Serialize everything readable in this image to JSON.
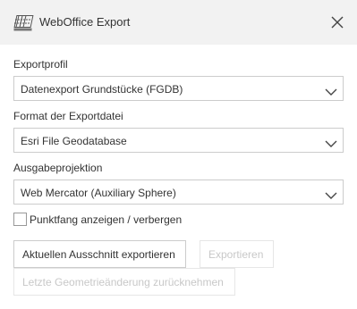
{
  "window": {
    "title": "WebOffice Export",
    "icon": "export-map-icon",
    "close_icon": "close-icon"
  },
  "form": {
    "export_profile": {
      "label": "Exportprofil",
      "value": "Datenexport Grundstücke (FGDB)"
    },
    "export_format": {
      "label": "Format der Exportdatei",
      "value": "Esri File Geodatabase"
    },
    "output_projection": {
      "label": "Ausgabeprojektion",
      "value": "Web Mercator (Auxiliary Sphere)"
    },
    "snap_checkbox": {
      "label": "Punktfang anzeigen / verbergen",
      "checked": false
    }
  },
  "actions": {
    "export_extent_label": "Aktuellen Ausschnitt exportieren",
    "export_label": "Exportieren",
    "undo_geometry_label": "Letzte Geometrieänderung zurücknehmen"
  },
  "colors": {
    "header_bg": "#f2f2f2",
    "border": "#cccccc",
    "disabled_text": "#c8c8c8",
    "text": "#333333"
  }
}
